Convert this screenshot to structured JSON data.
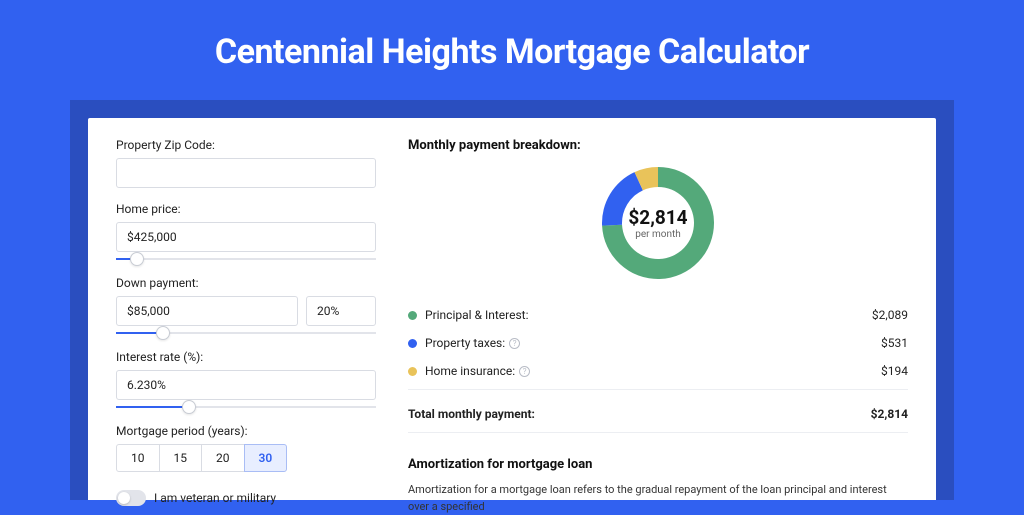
{
  "title": "Centennial Heights Mortgage Calculator",
  "form": {
    "zip_label": "Property Zip Code:",
    "zip_value": "",
    "home_price_label": "Home price:",
    "home_price_value": "$425,000",
    "home_price_fill_pct": 8,
    "down_payment_label": "Down payment:",
    "down_payment_value": "$85,000",
    "down_payment_pct": "20%",
    "down_payment_fill_pct": 18,
    "interest_label": "Interest rate (%):",
    "interest_value": "6.230%",
    "interest_fill_pct": 28,
    "period_label": "Mortgage period (years):",
    "periods": [
      "10",
      "15",
      "20",
      "30"
    ],
    "period_active": 3,
    "veteran_label": "I am veteran or military"
  },
  "breakdown": {
    "title": "Monthly payment breakdown:",
    "center_amount": "$2,814",
    "center_sub": "per month",
    "items": [
      {
        "label": "Principal & Interest:",
        "value": "$2,089",
        "color": "#54a97a",
        "info": false
      },
      {
        "label": "Property taxes:",
        "value": "$531",
        "color": "#3161f0",
        "info": true
      },
      {
        "label": "Home insurance:",
        "value": "$194",
        "color": "#e9c35a",
        "info": true
      }
    ],
    "total_label": "Total monthly payment:",
    "total_value": "$2,814"
  },
  "amort": {
    "title": "Amortization for mortgage loan",
    "text": "Amortization for a mortgage loan refers to the gradual repayment of the loan principal and interest over a specified"
  },
  "chart_data": {
    "type": "pie",
    "title": "Monthly payment breakdown",
    "series": [
      {
        "name": "Principal & Interest",
        "value": 2089,
        "color": "#54a97a"
      },
      {
        "name": "Property taxes",
        "value": 531,
        "color": "#3161f0"
      },
      {
        "name": "Home insurance",
        "value": 194,
        "color": "#e9c35a"
      }
    ],
    "total": 2814,
    "center_label": "$2,814 per month"
  }
}
